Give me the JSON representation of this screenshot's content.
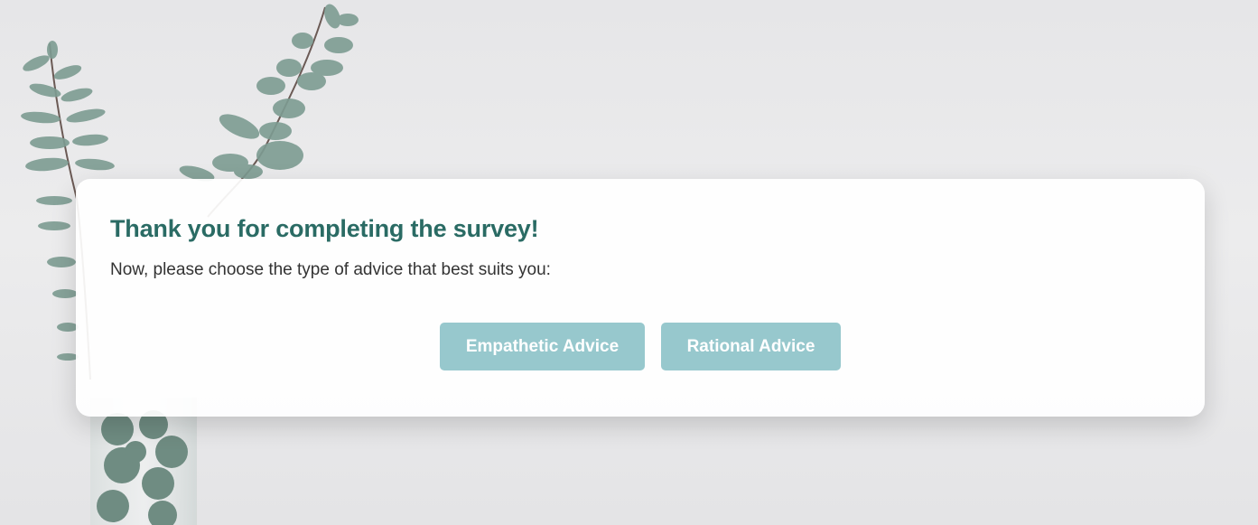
{
  "card": {
    "title": "Thank you for completing the survey!",
    "subtitle": "Now, please choose the type of advice that best suits you:"
  },
  "buttons": {
    "empathetic_label": "Empathetic Advice",
    "rational_label": "Rational Advice"
  },
  "colors": {
    "title": "#2a6b64",
    "button_bg": "#97c8cd",
    "button_text": "#ffffff",
    "card_bg": "#ffffff",
    "page_bg": "#e8e8ea"
  },
  "background": {
    "image": "eucalyptus-branches-in-glass-vase"
  }
}
